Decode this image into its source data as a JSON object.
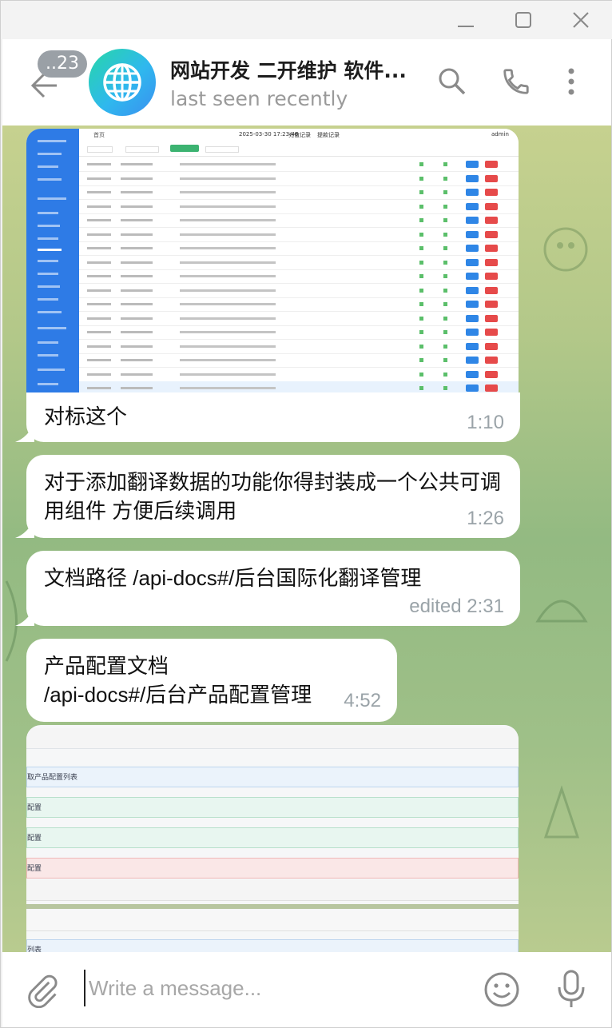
{
  "header": {
    "unread_count": "..23",
    "chat_title": "网站开发 二开维护 软件...",
    "chat_status": "last seen recently"
  },
  "messages": [
    {
      "text": "对标这个",
      "time": "1:10"
    },
    {
      "text": "对于添加翻译数据的功能你得封装成一个公共可调用组件 方便后续调用",
      "line1": "对于添加翻译数据的功能你得封装成一个公共可调",
      "line2": "用组件 方便后续调用",
      "time": "1:26"
    },
    {
      "text": "文档路径 /api-docs#/后台国际化翻译管理",
      "time": "edited 2:31"
    },
    {
      "line1": "产品配置文档",
      "line2": "/api-docs#/后台产品配置管理",
      "time": "4:52"
    }
  ],
  "screenshot1": {
    "breadcrumb": "首页",
    "datetime": "2025-03-30 17:23:46",
    "recharge": "充值记录",
    "withdraw": "提款记录",
    "user": "admin"
  },
  "screenshot2": {
    "rows": [
      "取产品配置列表",
      "配置",
      "配置",
      "配置",
      "列表"
    ]
  },
  "composer": {
    "placeholder": "Write a message..."
  },
  "colors": {
    "accent": "#3390ec",
    "bubble": "#ffffff",
    "time": "#9aa3a8"
  }
}
